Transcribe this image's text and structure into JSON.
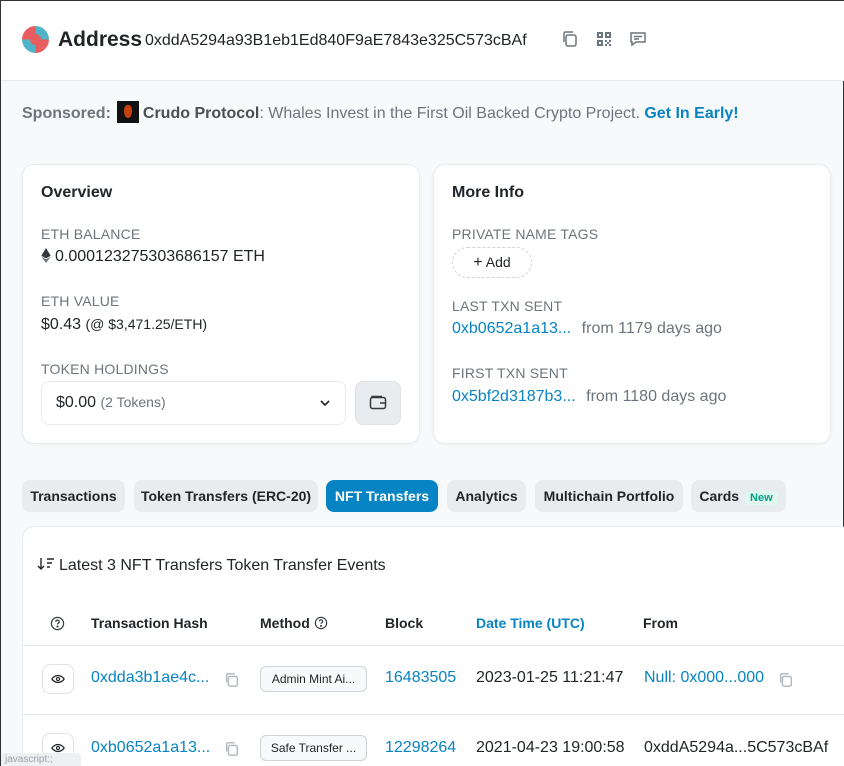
{
  "header": {
    "title": "Address",
    "address": "0xddA5294a93B1eb1Ed840F9aE7843e325C573cBAf"
  },
  "sponsor": {
    "label": "Sponsored:",
    "brand": "Crudo Protocol",
    "text": ": Whales Invest in the First Oil Backed Crypto Project.",
    "cta": "Get In Early!"
  },
  "overview": {
    "title": "Overview",
    "eth_balance_label": "ETH BALANCE",
    "eth_balance": "0.000123275303686157 ETH",
    "eth_value_label": "ETH VALUE",
    "eth_value": "$0.43",
    "eth_price": "(@ $3,471.25/ETH)",
    "token_holdings_label": "TOKEN HOLDINGS",
    "token_value": "$0.00",
    "token_count": "(2 Tokens)"
  },
  "more_info": {
    "title": "More Info",
    "private_tags_label": "PRIVATE NAME TAGS",
    "add_label": "Add",
    "last_txn_label": "LAST TXN SENT",
    "last_txn_hash": "0xb0652a1a13...",
    "last_txn_age": "from 1179 days ago",
    "first_txn_label": "FIRST TXN SENT",
    "first_txn_hash": "0x5bf2d3187b3...",
    "first_txn_age": "from 1180 days ago"
  },
  "tabs": [
    {
      "label": "Transactions"
    },
    {
      "label": "Token Transfers (ERC-20)"
    },
    {
      "label": "NFT Transfers"
    },
    {
      "label": "Analytics"
    },
    {
      "label": "Multichain Portfolio"
    },
    {
      "label": "Cards",
      "badge": "New"
    }
  ],
  "table": {
    "title": "Latest 3 NFT Transfers Token Transfer Events",
    "headers": {
      "txn_hash": "Transaction Hash",
      "method": "Method",
      "block": "Block",
      "date": "Date Time (UTC)",
      "from": "From"
    },
    "rows": [
      {
        "hash": "0xdda3b1ae4c...",
        "method": "Admin Mint Ai...",
        "block": "16483505",
        "date": "2023-01-25 11:21:47",
        "from": "Null: 0x000...000"
      },
      {
        "hash": "0xb0652a1a13...",
        "method": "Safe Transfer ...",
        "block": "12298264",
        "date": "2021-04-23 19:00:58",
        "from": "0xddA5294a...5C573cBAf"
      }
    ]
  },
  "footer_hint": "javascript:;",
  "colors": {
    "accent": "#0784c3",
    "text": "#212529",
    "muted": "#6c757d"
  }
}
